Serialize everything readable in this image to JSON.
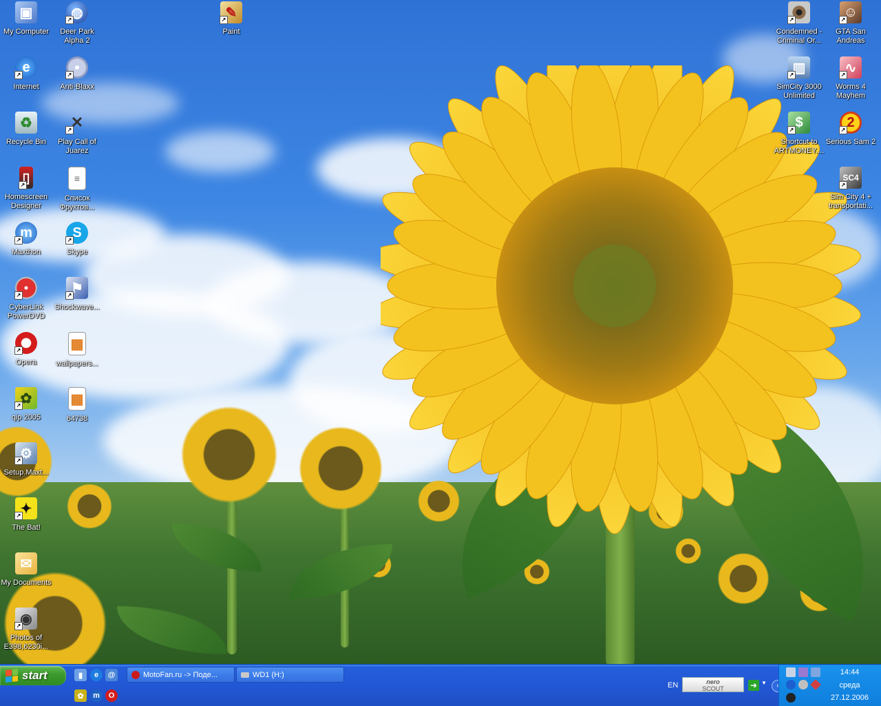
{
  "desktop": {
    "icons": [
      {
        "label": "My Computer",
        "icon": "my-computer-icon"
      },
      {
        "label": "Internet",
        "icon": "internet-explorer-icon"
      },
      {
        "label": "Recycle Bin",
        "icon": "recycle-bin-icon"
      },
      {
        "label": "Homescreen Designer",
        "icon": "phone-icon"
      },
      {
        "label": "Maxthon",
        "icon": "maxthon-icon"
      },
      {
        "label": "CyberLink PowerDVD",
        "icon": "dvd-icon"
      },
      {
        "label": "Opera",
        "icon": "opera-icon"
      },
      {
        "label": "qip 2005",
        "icon": "qip-icon"
      },
      {
        "label": "Setup.Maxt...",
        "icon": "installer-icon"
      },
      {
        "label": "The Bat!",
        "icon": "bat-mail-icon"
      },
      {
        "label": "My Documents",
        "icon": "my-documents-icon"
      },
      {
        "label": "Photos of E398,6230i...",
        "icon": "camera-icon"
      },
      {
        "label": "Deer Park Alpha 2",
        "icon": "firefox-globe-icon"
      },
      {
        "label": "Anti-Blaxx",
        "icon": "disc-icon"
      },
      {
        "label": "Play Call of Juarez",
        "icon": "pistols-icon"
      },
      {
        "label": "Список Фруктов...",
        "icon": "text-file-icon"
      },
      {
        "label": "Skype",
        "icon": "skype-icon"
      },
      {
        "label": "Shockwave...",
        "icon": "shockwave-icon"
      },
      {
        "label": "wallpapers...",
        "icon": "image-file-icon"
      },
      {
        "label": "64738",
        "icon": "image-file-icon"
      },
      {
        "label": "Paint",
        "icon": "paint-icon"
      },
      {
        "label": "Condemned - Criminal Or...",
        "icon": "eye-icon"
      },
      {
        "label": "SimCity 3000 Unlimited",
        "icon": "city-icon"
      },
      {
        "label": "Shortcut to ARTMONEY....",
        "icon": "money-icon"
      },
      {
        "label": "GTA San Andreas",
        "icon": "gta-icon"
      },
      {
        "label": "Worms 4 Mayhem",
        "icon": "worm-icon"
      },
      {
        "label": "Serious Sam 2",
        "icon": "serious-sam-icon"
      },
      {
        "label": "Sim City 4 + transportati...",
        "icon": "simcity4-icon"
      }
    ]
  },
  "taskbar": {
    "start_label": "start",
    "quick_launch": [
      {
        "icon": "show-desktop-icon",
        "glyph": "▮"
      },
      {
        "icon": "internet-explorer-icon",
        "glyph": "e"
      },
      {
        "icon": "browser-icon",
        "glyph": "@"
      },
      {
        "icon": "qip-icon",
        "glyph": "✿"
      },
      {
        "icon": "maxthon-icon",
        "glyph": "m"
      },
      {
        "icon": "opera-icon",
        "glyph": "O"
      }
    ],
    "tasks": [
      {
        "label": "MotoFan.ru -> Поде...",
        "icon": "opera-icon",
        "color": "#cc1b1b"
      },
      {
        "label": "WD1 (H:)",
        "icon": "drive-icon",
        "color": "#c8c8c8"
      }
    ],
    "language": "EN",
    "nero_label_top": "nero",
    "nero_label_bottom": "SCOUT",
    "tray": {
      "time": "14:44",
      "day": "среда",
      "date": "27.12.2006"
    }
  },
  "colors": {
    "taskbar": "#245edb",
    "start": "#3c9a2d",
    "tray": "#1488e5"
  }
}
